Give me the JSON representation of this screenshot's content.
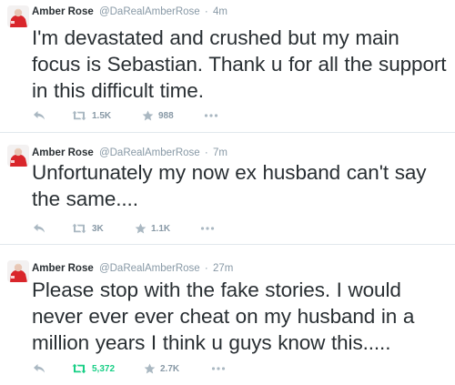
{
  "tweets": [
    {
      "author_name": "Amber Rose",
      "handle": "@DaRealAmberRose",
      "separator": "·",
      "time": "4m",
      "text": "I'm devastated and crushed but my main focus is Sebastian. Thank u for all the support in this difficult time.",
      "retweets": "1.5K",
      "favorites": "988",
      "retweeted": false
    },
    {
      "author_name": "Amber Rose",
      "handle": "@DaRealAmberRose",
      "separator": "·",
      "time": "7m",
      "text": "Unfortunately my now ex husband can't say the same....",
      "retweets": "3K",
      "favorites": "1.1K",
      "retweeted": false
    },
    {
      "author_name": "Amber Rose",
      "handle": "@DaRealAmberRose",
      "separator": "·",
      "time": "27m",
      "text": "Please stop with the fake stories. I would never ever ever cheat on my husband in a million years I think u guys know this.....",
      "retweets": "5,372",
      "favorites": "2.7K",
      "retweeted": true
    }
  ],
  "icons": {
    "avatar": "avatar",
    "reply": "reply-icon",
    "retweet": "retweet-icon",
    "favorite": "star-icon",
    "more": "more-dots-icon"
  },
  "colors": {
    "text": "#292f33",
    "muted": "#8899a6",
    "retweet_active": "#19cf86",
    "divider": "#e1e8ed",
    "avatar_red": "#d9262b"
  }
}
